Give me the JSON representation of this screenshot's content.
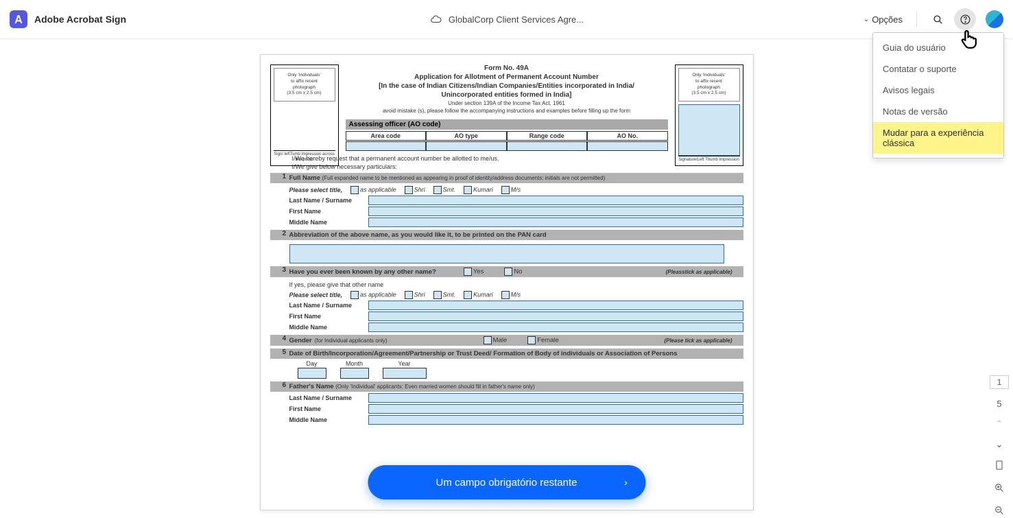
{
  "header": {
    "app_name": "Adobe Acrobat Sign",
    "document_title": "GlobalCorp Client Services Agre...",
    "options_label": "Opções"
  },
  "help_menu": {
    "items": [
      "Guia do usuário",
      "Contatar o suporte",
      "Avisos legais",
      "Notas de versão",
      "Mudar para a experiência clássica"
    ]
  },
  "form": {
    "title_lines": {
      "l1": "Form No. 49A",
      "l2": "Application for Allotment of Permanent Account Number",
      "l3": "[In the  case of Indian Citizens/Indian Companies/Entities incorporated in India/",
      "l4": "Unincorporated entities formed in India]",
      "l5": "Under section 139A of the Income Tax Act, 1961",
      "l6": "avoid mistake (s), please follow the accompanying instructions and examples before filling up the form"
    },
    "photo_note_lines": [
      "Only 'Individuals'",
      "to affix recent",
      "photograph",
      "(3.5 cm x 2.5 cm)"
    ],
    "left_sig": "Sign/ leftTumb impression across this photo",
    "right_sig": "Signature/Left Thumb Impression",
    "ao_header": "Assessing officer  (AO code)",
    "ao_cols": [
      "Area code",
      "AO type",
      "Range code",
      "AO No."
    ],
    "request1": "I/We hereby request that a permanent account number be allotted to me/us.",
    "request2": "I/We give below necessary particulars:",
    "s1": {
      "num": "1",
      "title": "Full Name",
      "note": "(Full expanded name to be mentioned as appearing in proof of identity/address documents: initials are not permitted)"
    },
    "title_select": "Please select title,",
    "as_applicable": "as applicable",
    "titles": {
      "shri": "Shri",
      "smt": "Smt.",
      "kumari": "Kumari",
      "ms": "M/s"
    },
    "name_labels": {
      "last": "Last Name / Surname",
      "first": "First Name",
      "middle": "Middle Name"
    },
    "s2": {
      "num": "2",
      "title": "Abbreviation of the above name, as you would like it, to be printed on the PAN card"
    },
    "s3": {
      "num": "3",
      "title": "Have you ever been known by any other name?",
      "yes": "Yes",
      "no": "No",
      "tick": "(Pleasstick as applicable)",
      "if_yes": "If yes, please give that other name"
    },
    "s4": {
      "num": "4",
      "title": "Gender",
      "note": "(for Individual applicants only)",
      "male": "Male",
      "female": "Female",
      "tick": "(Please tick as applicable)"
    },
    "s5": {
      "num": "5",
      "title": "Date of Birth/Incorporation/Agreement/Partnership or Trust Deed/ Formation of Body of individuals or Association of Persons",
      "day": "Day",
      "month": "Month",
      "year": "Year"
    },
    "s6": {
      "num": "6",
      "title": "Father's Name",
      "note": "(Only 'Individual' applicants: Even married women should fill in father's name only)"
    }
  },
  "action_button": "Um campo obrigatório restante",
  "pager": {
    "current": "1",
    "total": "5"
  }
}
